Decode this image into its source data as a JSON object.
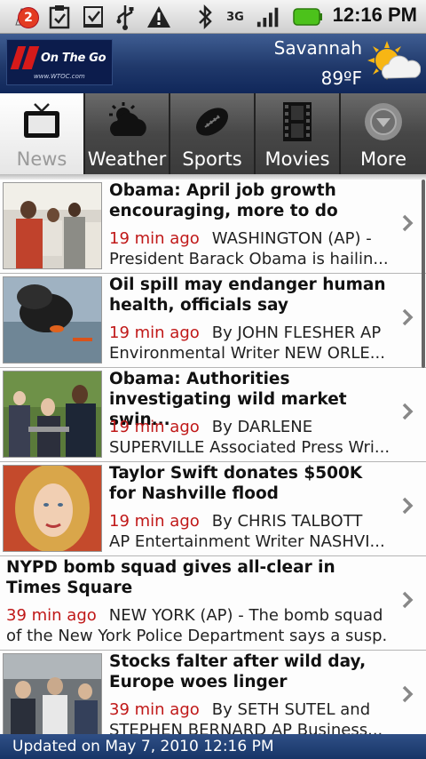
{
  "status_bar": {
    "notification_count": "2",
    "time": "12:16 PM",
    "network_type": "3G",
    "icons": [
      "notification-count-icon",
      "clipboard-icon",
      "download-icon",
      "usb-icon",
      "warning-icon",
      "bluetooth-icon",
      "network-3g-icon",
      "signal-icon",
      "battery-icon"
    ]
  },
  "header": {
    "logo_text": "On The Go",
    "logo_url": "www.WTOC.com",
    "city": "Savannah",
    "temperature": "89ºF",
    "weather_icon": "partly-sunny-icon"
  },
  "tabs": [
    {
      "label": "News",
      "icon": "tv-icon",
      "active": true
    },
    {
      "label": "Weather",
      "icon": "weather-cloud-icon",
      "active": false
    },
    {
      "label": "Sports",
      "icon": "football-icon",
      "active": false
    },
    {
      "label": "Movies",
      "icon": "film-strip-icon",
      "active": false
    },
    {
      "label": "More",
      "icon": "more-arrow-icon",
      "active": false
    }
  ],
  "news": [
    {
      "headline": "Obama: April job growth encouraging, more to do",
      "time": "19 min ago",
      "snippet_1": "WASHINGTON (AP) -",
      "snippet_2": "President Barack Obama is hailin...",
      "has_thumb": true
    },
    {
      "headline": "Oil spill may endanger human health, officials say",
      "time": "19 min ago",
      "snippet_1": "By JOHN FLESHER AP",
      "snippet_2": "Environmental Writer NEW ORLE...",
      "has_thumb": true
    },
    {
      "headline": "Obama: Authorities investigating wild market swin...",
      "time": "19 min ago",
      "snippet_1": "By DARLENE",
      "snippet_2": "SUPERVILLE Associated Press Wri...",
      "has_thumb": true
    },
    {
      "headline": "Taylor Swift donates $500K for Nashville flood",
      "time": "19 min ago",
      "snippet_1": "By CHRIS TALBOTT",
      "snippet_2": "AP Entertainment Writer NASHVI...",
      "has_thumb": true
    },
    {
      "headline": "NYPD bomb squad gives all-clear in Times Square",
      "time": "39 min ago",
      "snippet_1": "NEW YORK (AP) - The bomb squad",
      "snippet_2": "of the New York Police Department says a susp...",
      "has_thumb": false
    },
    {
      "headline": "Stocks falter after wild day, Europe woes linger",
      "time": "39 min ago",
      "snippet_1": "By SETH SUTEL and",
      "snippet_2": "STEPHEN BERNARD AP Business...",
      "has_thumb": true
    }
  ],
  "footer": {
    "updated": "Updated on May 7, 2010 12:16 PM"
  },
  "colors": {
    "header_blue": "#20396b",
    "time_red": "#c01818",
    "active_tab_bg": "#f2f2f2",
    "inactive_tab_bg": "#474747"
  }
}
